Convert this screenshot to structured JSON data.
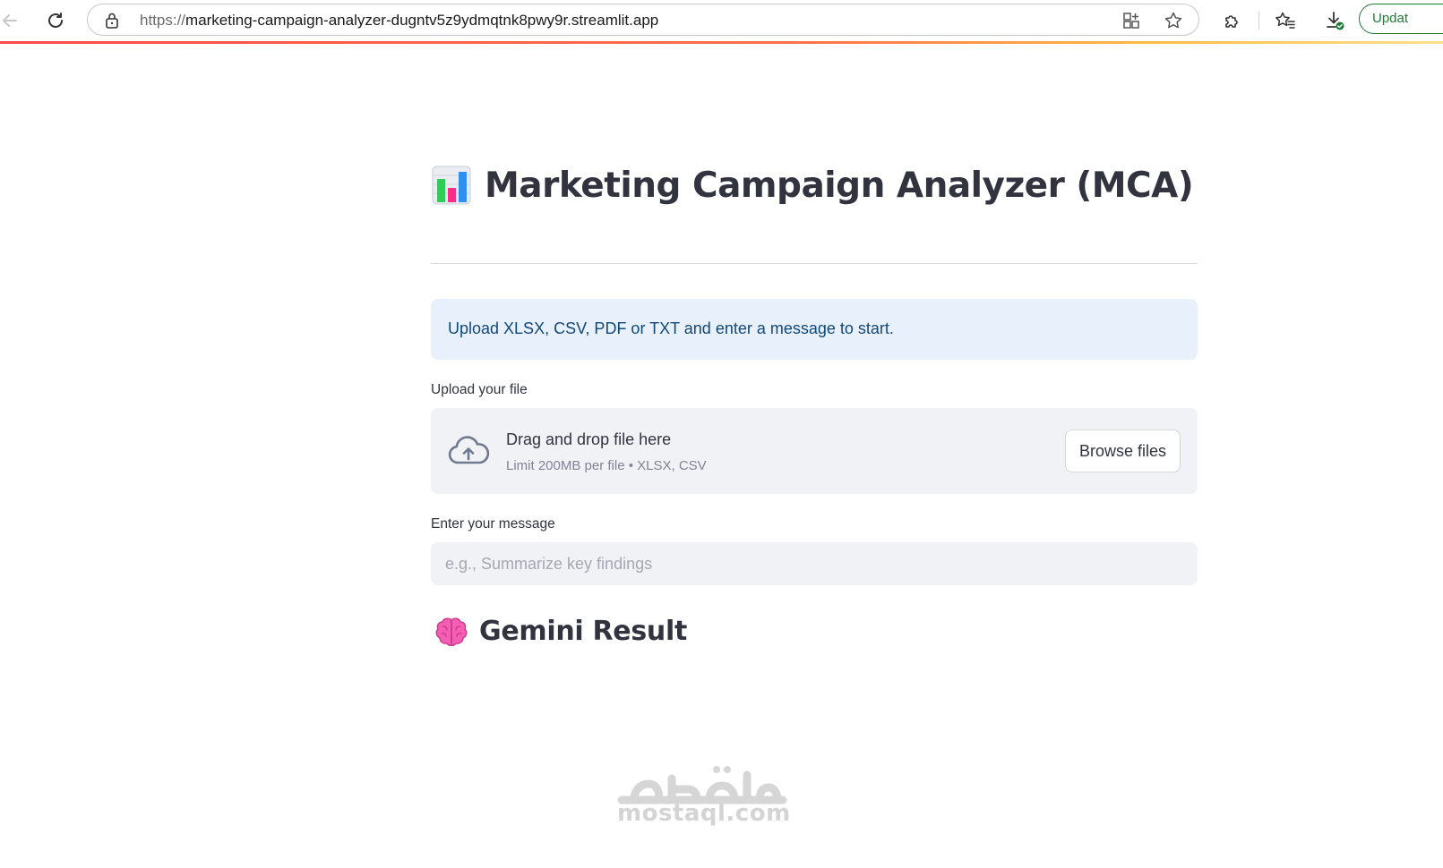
{
  "browser": {
    "url_scheme": "https://",
    "url_host": "marketing-campaign-analyzer-dugntv5z9ydmqtnk8pwy9r.streamlit.app",
    "update_label": "Updat",
    "accent_color": "#1e7c35"
  },
  "app": {
    "title": "Marketing Campaign Analyzer (MCA)",
    "title_icon": "bar-chart-icon",
    "info_message": "Upload XLSX, CSV, PDF or TXT and enter a message to start.",
    "uploader": {
      "label": "Upload your file",
      "drop_text": "Drag and drop file here",
      "limit_text": "Limit 200MB per file • XLSX, CSV",
      "browse_label": "Browse files"
    },
    "message": {
      "label": "Enter your message",
      "placeholder": "e.g., Summarize key findings",
      "value": ""
    },
    "result": {
      "title": "Gemini Result",
      "icon": "brain-icon"
    }
  },
  "watermark": {
    "text": "mostaql.com",
    "arabic": "مستقل"
  }
}
